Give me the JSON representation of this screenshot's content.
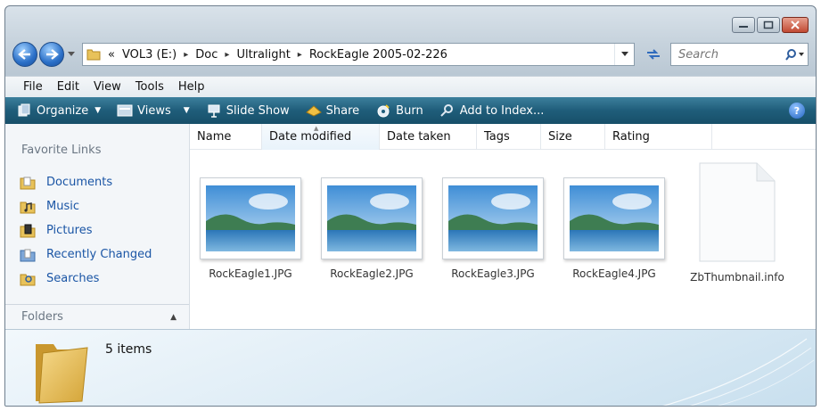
{
  "window": {
    "controls": [
      "minimize",
      "maximize",
      "close"
    ]
  },
  "address_bar": {
    "prefix": "«",
    "crumbs": [
      "VOL3 (E:)",
      "Doc",
      "Ultralight",
      "RockEagle 2005-02-226"
    ],
    "separator": "▸"
  },
  "search": {
    "placeholder": "Search"
  },
  "menu": [
    "File",
    "Edit",
    "View",
    "Tools",
    "Help"
  ],
  "toolbar": {
    "organize": "Organize",
    "views": "Views",
    "slideshow": "Slide Show",
    "share": "Share",
    "burn": "Burn",
    "add_index": "Add to Index...",
    "help": "?"
  },
  "nav_pane": {
    "title": "Favorite Links",
    "items": [
      "Documents",
      "Music",
      "Pictures",
      "Recently Changed",
      "Searches"
    ],
    "folders_label": "Folders"
  },
  "columns": [
    "Name",
    "Date modified",
    "Date taken",
    "Tags",
    "Size",
    "Rating"
  ],
  "files": [
    {
      "name": "RockEagle1.JPG",
      "kind": "image"
    },
    {
      "name": "RockEagle2.JPG",
      "kind": "image"
    },
    {
      "name": "RockEagle3.JPG",
      "kind": "image"
    },
    {
      "name": "RockEagle4.JPG",
      "kind": "image"
    },
    {
      "name": "ZbThumbnail.info",
      "kind": "document"
    }
  ],
  "details": {
    "count": "5 items"
  },
  "colors": {
    "toolbar": "#1f5d7a",
    "link": "#1a55a5",
    "window_frame": "#c7d3dd"
  }
}
